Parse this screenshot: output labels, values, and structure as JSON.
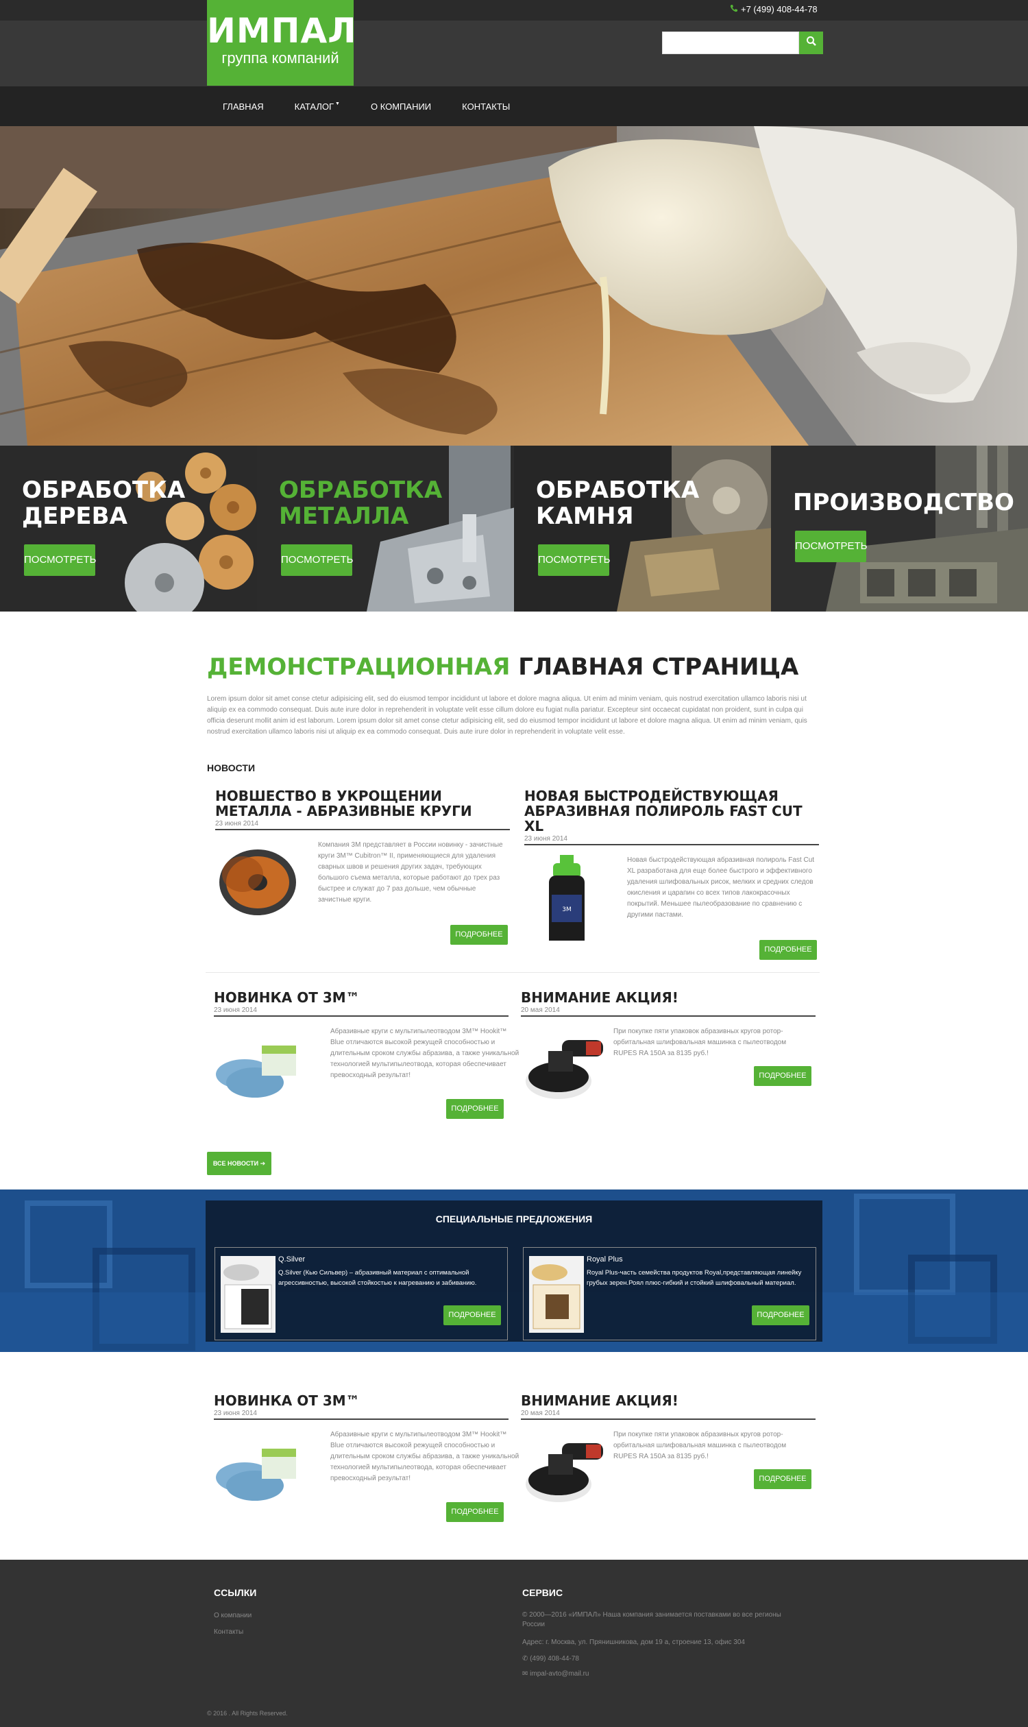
{
  "header": {
    "logo_title": "ИМПАЛ",
    "logo_subtitle": "группа компаний",
    "phone": "+7 (499) 408-44-78",
    "search_placeholder": ""
  },
  "nav": {
    "items": [
      {
        "label": "ГЛАВНАЯ"
      },
      {
        "label": "КАТАЛОГ"
      },
      {
        "label": "О КОМПАНИИ"
      },
      {
        "label": "КОНТАКТЫ"
      }
    ]
  },
  "categories": [
    {
      "title": "ОБРАБОТКА ДЕРЕВА",
      "button": "ПОСМОТРЕТЬ"
    },
    {
      "title": "ОБРАБОТКА МЕТАЛЛА",
      "button": "ПОСМОТРЕТЬ"
    },
    {
      "title": "ОБРАБОТКА КАМНЯ",
      "button": "ПОСМОТРЕТЬ"
    },
    {
      "title": "ПРОИЗВОДСТВО",
      "button": "ПОСМОТРЕТЬ"
    }
  ],
  "intro": {
    "title_green": "ДЕМОНСТРАЦИОННАЯ",
    "title_dark": "ГЛАВНАЯ СТРАНИЦА",
    "text": "Lorem ipsum dolor sit amet conse ctetur adipisicing elit, sed do eiusmod tempor incididunt ut labore et dolore magna aliqua. Ut enim ad minim veniam, quis nostrud exercitation ullamco laboris nisi ut aliquip ex ea commodo consequat. Duis aute irure dolor in reprehenderit in voluptate velit esse cillum dolore eu fugiat nulla pariatur. Excepteur sint occaecat cupidatat non proident, sunt in culpa qui officia deserunt mollit anim id est laborum. Lorem ipsum dolor sit amet conse ctetur adipisicing elit, sed do eiusmod tempor incididunt ut labore et dolore magna aliqua. Ut enim ad minim veniam, quis nostrud exercitation ullamco laboris nisi ut aliquip ex ea commodo consequat. Duis aute irure dolor in reprehenderit in voluptate velit esse."
  },
  "news_label": "НОВОСТИ",
  "news": [
    {
      "title": "НОВШЕСТВО В УКРОЩЕНИИ МЕТАЛЛА - АБРАЗИВНЫЕ КРУГИ",
      "date": "23 июня 2014",
      "text": "Компания 3М представляет в России новинку - зачистные круги 3M™ Cubitron™ II, применяющиеся для удаления сварных швов и решения других задач, требующих большого съема металла, которые работают до трех раз быстрее и служат до 7 раз дольше, чем обычные зачистные круги.",
      "button": "ПОДРОБНЕЕ"
    },
    {
      "title": "НОВАЯ БЫСТРОДЕЙСТВУЮЩАЯ АБРАЗИВНАЯ ПОЛИРОЛЬ FAST CUT XL",
      "date": "23 июня 2014",
      "text": "Новая быстродействующая абразивная полироль Fast Cut XL разработана для еще более быстрого и эффективного удаления шлифовальных рисок, мелких и средних следов окисления и царапин со всех типов лакокрасочных покрытий. Меньшее пылеобразование по сравнению с другими пастами.",
      "button": "ПОДРОБНЕЕ"
    },
    {
      "title": "НОВИНКА ОТ 3М™",
      "date": "23 июня 2014",
      "text": "Абразивные круги с мультипылеотводом 3M™ Hookit™ Blue отличаются высокой режущей способностью и длительным сроком службы абразива, а также уникальной технологией мультипылеотвода, которая обеспечивает превосходный результат!",
      "button": "ПОДРОБНЕЕ"
    },
    {
      "title": "ВНИМАНИЕ АКЦИЯ!",
      "date": "20 мая 2014",
      "text": "При покупке пяти упаковок абразивных кругов ротор-орбитальная шлифовальная машинка с пылеотводом RUPES RA 150A за 8135 руб.!",
      "button": "ПОДРОБНЕЕ"
    }
  ],
  "all_news_button": "ВСЕ НОВОСТИ ➔",
  "special": {
    "heading": "СПЕЦИАЛЬНЫЕ ПРЕДЛОЖЕНИЯ",
    "offers": [
      {
        "title": "Q.Silver",
        "text": "Q.Silver (Кью Сильвер) – абразивный материал с оптимальной агрессивностью, высокой стойкостью к нагреванию и забиванию.",
        "button": "ПОДРОБНЕЕ"
      },
      {
        "title": "Royal Plus",
        "text": "Royal Plus-часть семейства продуктов Royal,представляющая линейку грубых зерен.Роял плюс-гибкий и стойкий шлифовальный материал.",
        "button": "ПОДРОБНЕЕ"
      }
    ]
  },
  "news_bottom": [
    {
      "title": "НОВИНКА ОТ 3М™",
      "date": "23 июня 2014",
      "text": "Абразивные круги с мультипылеотводом 3M™ Hookit™ Blue отличаются высокой режущей способностью и длительным сроком службы абразива, а также уникальной технологией мультипылеотвода, которая обеспечивает превосходный результат!",
      "button": "ПОДРОБНЕЕ"
    },
    {
      "title": "ВНИМАНИЕ АКЦИЯ!",
      "date": "20 мая 2014",
      "text": "При покупке пяти упаковок абразивных кругов ротор-орбитальная шлифовальная машинка с пылеотводом RUPES RA 150A за 8135 руб.!",
      "button": "ПОДРОБНЕЕ"
    }
  ],
  "footer": {
    "links_heading": "ССЫЛКИ",
    "links": [
      "О компании",
      "Контакты"
    ],
    "service_heading": "СЕРВИС",
    "service_text": "© 2000—2016 «ИМПАЛ» Наша компания занимается поставками во все регионы России",
    "address": "Адрес: г. Москва, ул. Прянишникова, дом 19 а, строение 13, офис 304",
    "phone": "(499) 408-44-78",
    "email": "impal-avto@mail.ru",
    "copyright": "© 2016 . All Rights Reserved."
  },
  "colors": {
    "accent": "#55b236",
    "header": "#393939",
    "nav": "#232323",
    "footer": "#333333"
  }
}
